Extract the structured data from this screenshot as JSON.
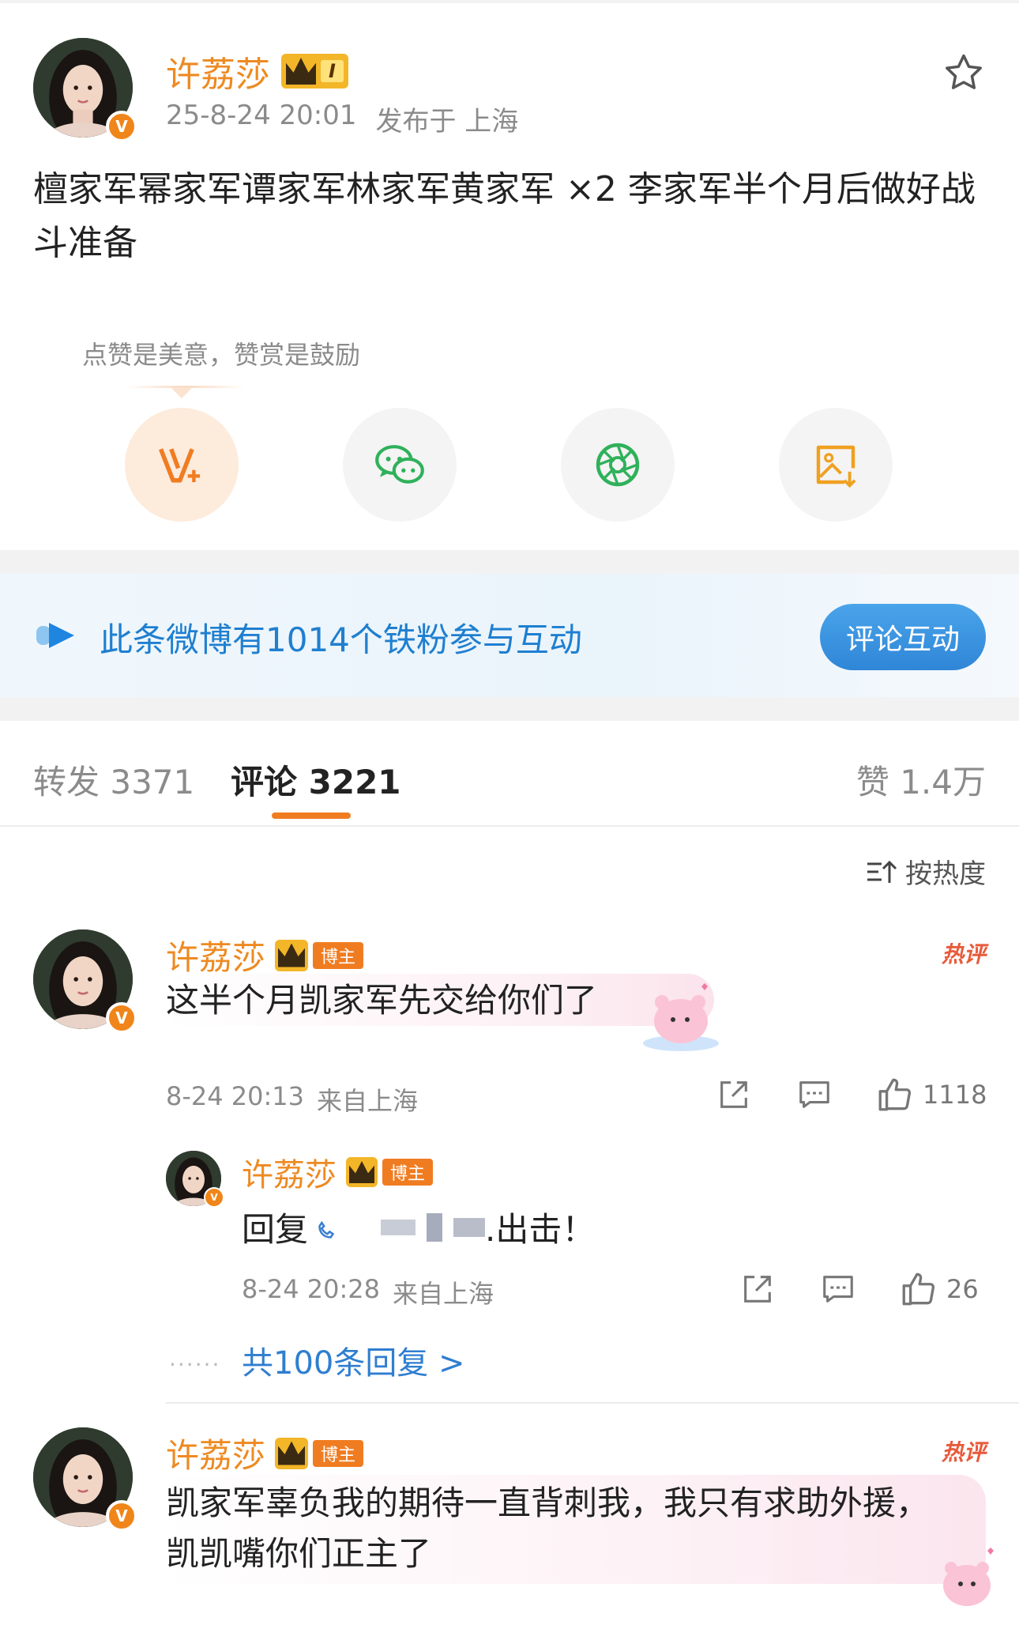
{
  "post": {
    "author": "许荔莎",
    "level_badge": "I",
    "verified_mark": "V",
    "time": "25-8-24 20:01",
    "location": "发布于 上海",
    "text": "檀家军幂家军谭家军林家军黄家军 ×2 李家军半个月后做好战斗准备",
    "reward_hint": "点赞是美意，赞赏是鼓励",
    "icons": [
      "star-icon",
      "reward-icon",
      "wechat-icon",
      "moments-icon",
      "save-image-icon"
    ]
  },
  "banner": {
    "text": "此条微博有1014个铁粉参与互动",
    "button": "评论互动"
  },
  "tabs": {
    "repost": "转发 3371",
    "comment": "评论 3221",
    "like": "赞 1.4万"
  },
  "sort_label": "按热度",
  "comments": [
    {
      "author": "许荔莎",
      "tag": "博主",
      "hot": "热评",
      "text": "这半个月凯家军先交给你们了",
      "time": "8-24 20:13",
      "location": "来自上海",
      "likes": "1118"
    },
    {
      "author": "许荔莎",
      "tag": "博主",
      "hot": "热评",
      "text": "凯家军辜负我的期待一直背刺我，我只有求助外援，凯凯嘴你们正主了"
    }
  ],
  "reply": {
    "author": "许荔莎",
    "tag": "博主",
    "prefix": "回复",
    "suffix": ".出击！",
    "time": "8-24 20:28",
    "location": "来自上海",
    "likes": "26",
    "more": "共100条回复 >"
  },
  "colors": {
    "accent": "#f07c21",
    "link": "#2f7ed0",
    "name": "#ee8a22"
  }
}
